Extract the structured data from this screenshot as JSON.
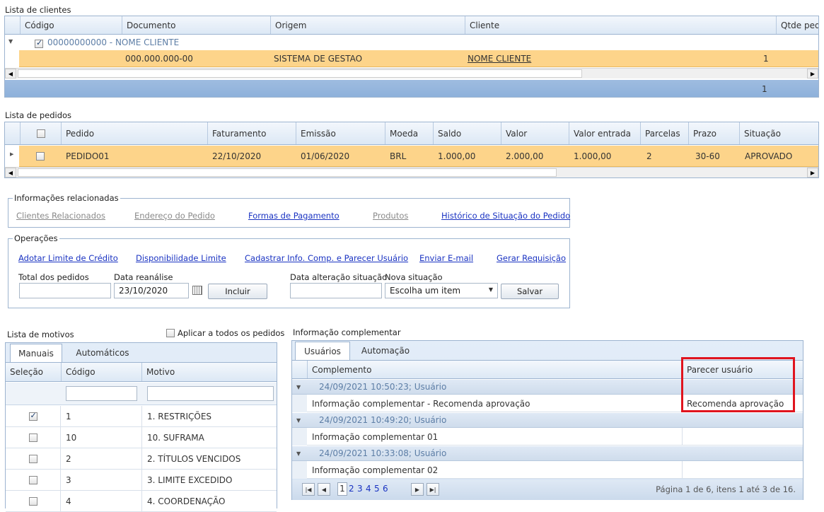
{
  "clientes": {
    "title": "Lista de clientes",
    "columns": [
      "Código",
      "Documento",
      "Origem",
      "Cliente",
      "Qtde pedidos"
    ],
    "group_label": "00000000000 - NOME CLIENTE",
    "row": {
      "documento": "000.000.000-00",
      "origem": "SISTEMA DE GESTAO",
      "cliente": "NOME CLIENTE",
      "qtde": "1"
    },
    "footer_total": "1"
  },
  "pedidos": {
    "title": "Lista de pedidos",
    "columns": [
      "Pedido",
      "Faturamento",
      "Emissão",
      "Moeda",
      "Saldo",
      "Valor",
      "Valor entrada",
      "Parcelas",
      "Prazo",
      "Situação"
    ],
    "row": {
      "pedido": "PEDIDO01",
      "faturamento": "22/10/2020",
      "emissao": "01/06/2020",
      "moeda": "BRL",
      "saldo": "1.000,00",
      "valor": "2.000,00",
      "valor_entrada": "1.000,00",
      "parcelas": "2",
      "prazo": "30-60",
      "situacao": "APROVADO"
    }
  },
  "info": {
    "legend": "Informações relacionadas",
    "links": [
      "Clientes Relacionados",
      "Endereço do Pedido",
      "Formas de Pagamento",
      "Produtos",
      "Histórico de Situação do Pedido"
    ]
  },
  "operacoes": {
    "legend": "Operações",
    "links": [
      "Adotar Limite de Crédito",
      "Disponibilidade Limite",
      "Cadastrar Info. Comp. e Parecer Usuário",
      "Enviar E-mail",
      "Gerar Requisição"
    ],
    "total_label": "Total dos pedidos",
    "data_reanalise_label": "Data reanálise",
    "data_reanalise_value": "23/10/2020",
    "incluir": "Incluir",
    "data_alteracao_label": "Data alteração situação",
    "nova_situacao_label": "Nova situação",
    "nova_situacao_value": "Escolha um item",
    "salvar": "Salvar"
  },
  "motivos": {
    "title": "Lista de motivos",
    "aplicar": "Aplicar a todos os pedidos",
    "tabs": [
      "Manuais",
      "Automáticos"
    ],
    "columns": [
      "Seleção",
      "Código",
      "Motivo"
    ],
    "rows": [
      {
        "checked": true,
        "codigo": "1",
        "motivo": "1. RESTRIÇÕES"
      },
      {
        "checked": false,
        "codigo": "10",
        "motivo": "10. SUFRAMA"
      },
      {
        "checked": false,
        "codigo": "2",
        "motivo": "2. TÍTULOS VENCIDOS"
      },
      {
        "checked": false,
        "codigo": "3",
        "motivo": "3. LIMITE EXCEDIDO"
      },
      {
        "checked": false,
        "codigo": "4",
        "motivo": "4. COORDENAÇÃO"
      }
    ]
  },
  "complementar": {
    "title": "Informação complementar",
    "tabs": [
      "Usuários",
      "Automação"
    ],
    "columns": [
      "Complemento",
      "Parecer usuário"
    ],
    "groups": [
      {
        "header": "24/09/2021 10:50:23; Usuário",
        "complemento": "Informação complementar - Recomenda aprovação",
        "parecer": "Recomenda aprovação"
      },
      {
        "header": "24/09/2021 10:49:20; Usuário",
        "complemento": "Informação complementar 01",
        "parecer": ""
      },
      {
        "header": "24/09/2021 10:33:08; Usuário",
        "complemento": "Informação complementar 02",
        "parecer": ""
      }
    ],
    "pages": [
      "1",
      "2",
      "3",
      "4",
      "5",
      "6"
    ],
    "pager_info": "Página 1 de 6, itens 1 até 3 de 16.",
    "highlight_color": "#e0141e"
  }
}
